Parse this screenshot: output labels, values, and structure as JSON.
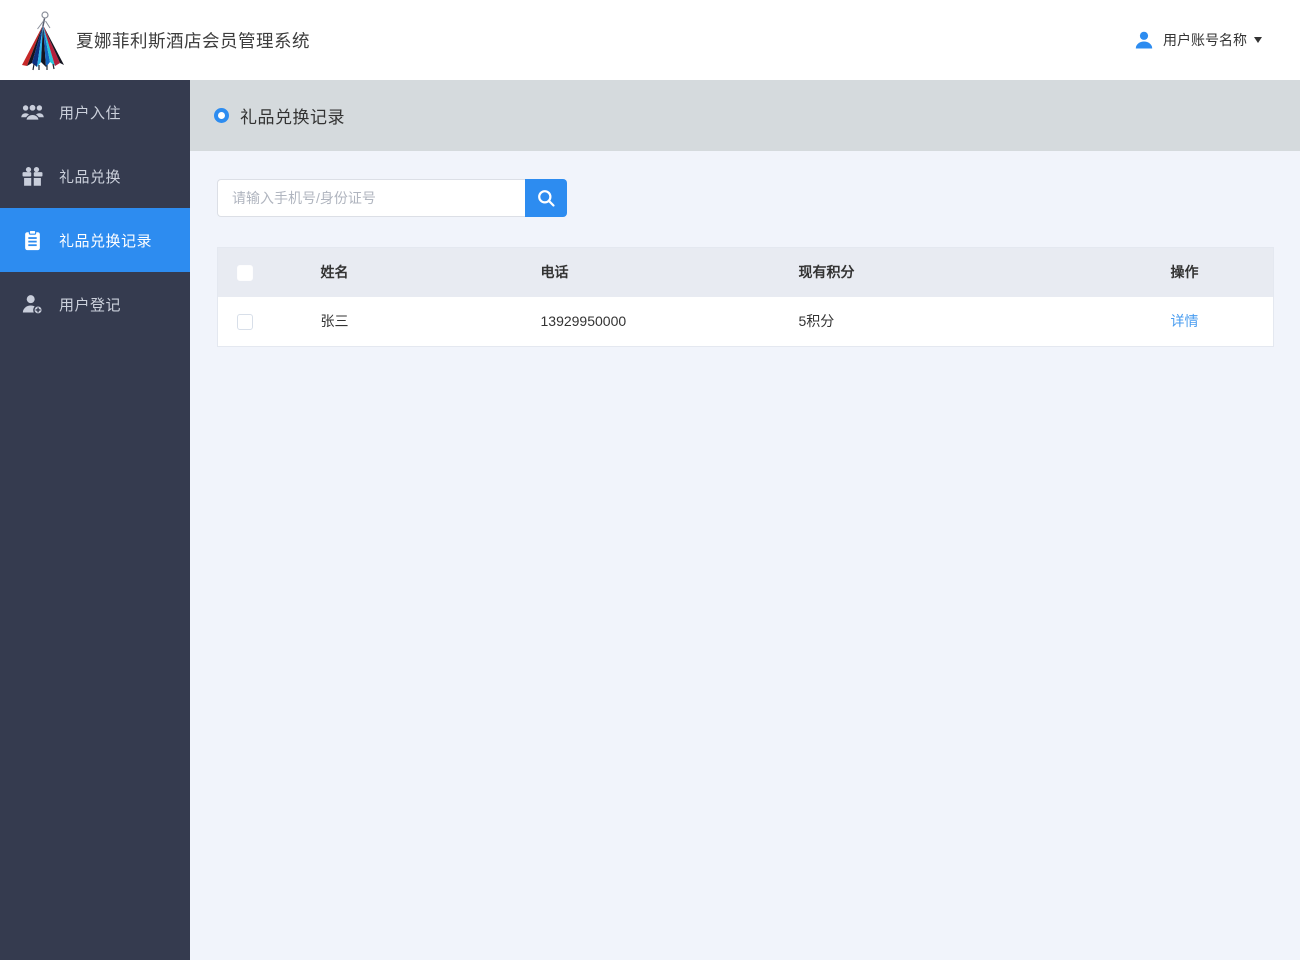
{
  "header": {
    "title": "夏娜菲利斯酒店会员管理系统",
    "logo_icon": "fashion-figure-logo",
    "user": {
      "icon": "user-icon",
      "name": "用户账号名称",
      "caret": "caret-down-icon"
    }
  },
  "sidebar": {
    "items": [
      {
        "icon": "users-icon",
        "label": "用户入住",
        "active": false
      },
      {
        "icon": "gift-icon",
        "label": "礼品兑换",
        "active": false
      },
      {
        "icon": "clipboard-icon",
        "label": "礼品兑换记录",
        "active": true
      },
      {
        "icon": "user-add-icon",
        "label": "用户登记",
        "active": false
      }
    ]
  },
  "main": {
    "page_title": "礼品兑换记录",
    "title_icon": "ring-icon",
    "search": {
      "placeholder": "请输入手机号/身份证号",
      "button_icon": "search-icon"
    },
    "table": {
      "headers": [
        "姓名",
        "电话",
        "现有积分",
        "操作"
      ],
      "rows": [
        {
          "name": "张三",
          "phone": "13929950000",
          "points": "5积分",
          "action": "详情",
          "checked": false
        }
      ]
    }
  },
  "colors": {
    "accent": "#2d8cf0",
    "sidebar_bg": "#353b4f",
    "titlebar_bg": "#d5dadd",
    "page_bg": "#f1f4fb",
    "table_header_bg": "#e8ebf2",
    "points_orange": "#ff7519",
    "link_blue": "#4a9df0"
  }
}
